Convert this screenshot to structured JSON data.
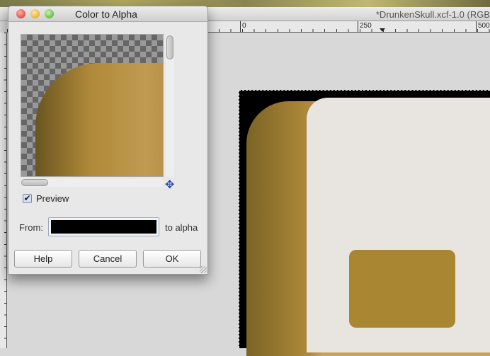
{
  "window": {
    "title": "*DrunkenSkull.xcf-1.0 (RGB"
  },
  "ruler": {
    "labels": [
      "0",
      "250",
      "500"
    ]
  },
  "dialog": {
    "title": "Color to Alpha",
    "preview_label": "Preview",
    "preview_checked": true,
    "from_label": "From:",
    "from_color": "#000000",
    "to_alpha_label": "to alpha",
    "buttons": {
      "help": "Help",
      "cancel": "Cancel",
      "ok": "OK"
    }
  }
}
